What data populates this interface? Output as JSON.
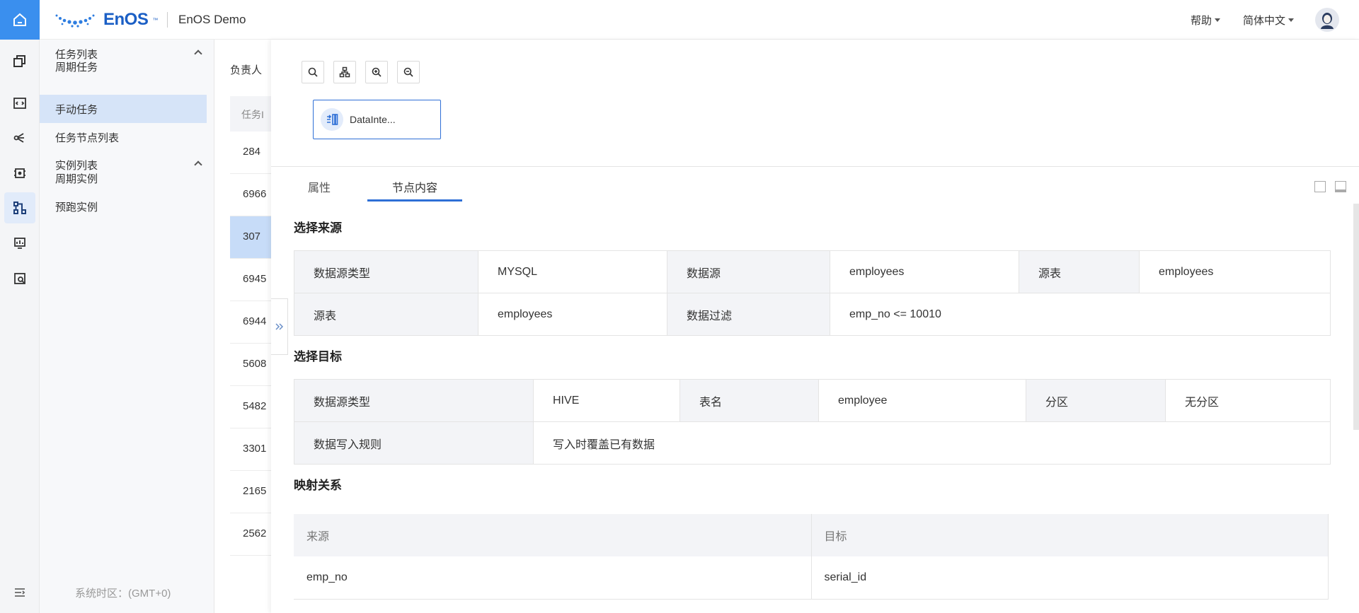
{
  "header": {
    "brand": "EnOS",
    "trademark": "™",
    "org_name": "EnOS Demo",
    "help_label": "帮助",
    "language_label": "简体中文"
  },
  "rail": {
    "icons": [
      "home-icon",
      "cube-stack-icon",
      "code-icon",
      "tree-icon",
      "chip-icon",
      "workflow-icon",
      "dashboard-icon",
      "analytics-icon",
      "menu-toggle-icon"
    ],
    "active_index": 5
  },
  "nav": {
    "groups": [
      {
        "label": "任务列表",
        "items": [
          "周期任务",
          "手动任务",
          "任务节点列表"
        ]
      },
      {
        "label": "实例列表",
        "items": [
          "周期实例",
          "预跑实例"
        ]
      }
    ],
    "active_item": "手动任务",
    "timezone": "系统时区：(GMT+0)"
  },
  "background_list": {
    "owner_label": "负责人",
    "id_header": "任务I",
    "rows": [
      "284",
      "6966",
      "307",
      "6945",
      "6944",
      "5608",
      "5482",
      "3301",
      "2165",
      "2562"
    ],
    "selected_row": "307"
  },
  "graph": {
    "node_label": "DataInte..."
  },
  "tabs": {
    "items": [
      "属性",
      "节点内容"
    ],
    "active": "节点内容"
  },
  "source": {
    "title": "选择来源",
    "row1": {
      "k1": "数据源类型",
      "v1": "MYSQL",
      "k2": "数据源",
      "v2": "employees",
      "k3": "源表",
      "v3": "employees"
    },
    "row2": {
      "k1": "源表",
      "v1": "employees",
      "k2": "数据过滤",
      "v2": "emp_no <= 10010"
    }
  },
  "target": {
    "title": "选择目标",
    "row1": {
      "k1": "数据源类型",
      "v1": "HIVE",
      "k2": "表名",
      "v2": "employee",
      "k3": "分区",
      "v3": "无分区"
    },
    "row2": {
      "k1": "数据写入规则",
      "v1": "写入时覆盖已有数据"
    }
  },
  "mapping": {
    "title": "映射关系",
    "headers": {
      "source": "来源",
      "target": "目标"
    },
    "rows": [
      {
        "source": "emp_no",
        "target": "serial_id"
      }
    ]
  },
  "colors": {
    "accent": "#2e6fd6",
    "rail_active": "#3a8fee",
    "nav_active_bg": "#d6e4f8"
  }
}
